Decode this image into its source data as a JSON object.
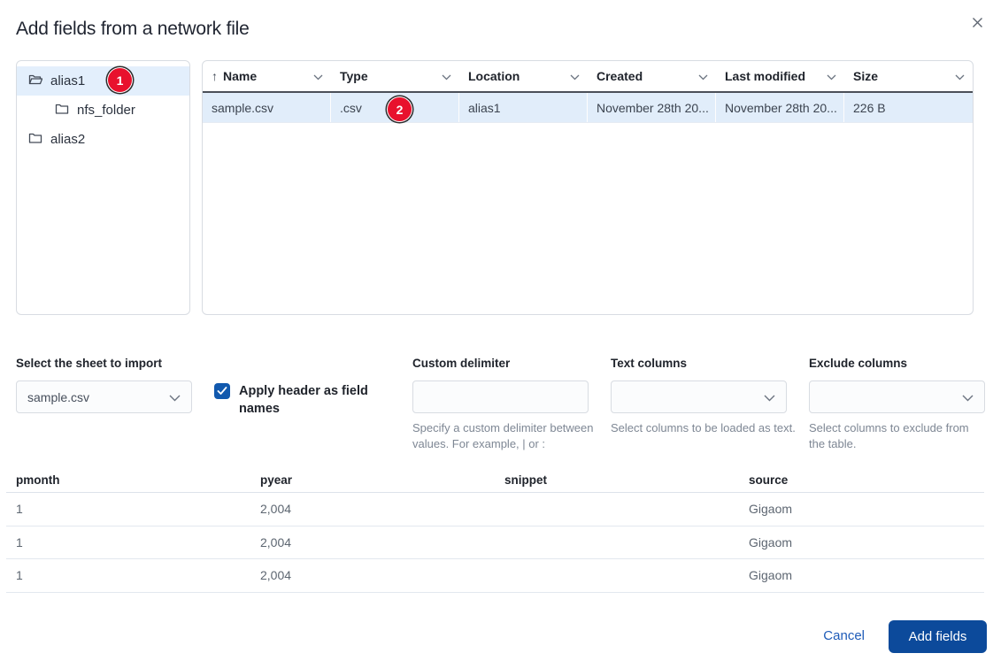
{
  "dialog": {
    "title": "Add fields from a network file"
  },
  "tree": {
    "items": [
      {
        "label": "alias1",
        "state": "open",
        "selected": true,
        "indent": 0
      },
      {
        "label": "nfs_folder",
        "state": "closed",
        "selected": false,
        "indent": 1
      },
      {
        "label": "alias2",
        "state": "closed",
        "selected": false,
        "indent": 0
      }
    ]
  },
  "files_table": {
    "columns": [
      "Name",
      "Type",
      "Location",
      "Created",
      "Last modified",
      "Size"
    ],
    "sort": {
      "column": "Name",
      "direction": "ascending"
    },
    "rows": [
      {
        "name": "sample.csv",
        "type": ".csv",
        "location": "alias1",
        "created": "November 28th 20...",
        "last_modified": "November 28th 20...",
        "size": "226 B",
        "selected": true
      }
    ]
  },
  "options": {
    "sheet": {
      "label": "Select the sheet to import",
      "value": "sample.csv"
    },
    "header_names": {
      "label": "Apply header as field names",
      "checked": true
    },
    "delimiter": {
      "label": "Custom delimiter",
      "value": "",
      "helper": "Specify a custom delimiter between values. For example, | or :"
    },
    "text_columns": {
      "label": "Text columns",
      "value": "",
      "helper": "Select columns to be loaded as text."
    },
    "exclude_columns": {
      "label": "Exclude columns",
      "value": "",
      "helper": "Select columns to exclude from the table."
    }
  },
  "preview_table": {
    "columns": [
      "pmonth",
      "pyear",
      "snippet",
      "source"
    ],
    "rows": [
      [
        "1",
        "2,004",
        "",
        "Gigaom"
      ],
      [
        "1",
        "2,004",
        "",
        "Gigaom"
      ],
      [
        "1",
        "2,004",
        "",
        "Gigaom"
      ]
    ]
  },
  "footer": {
    "cancel_label": "Cancel",
    "submit_label": "Add fields"
  },
  "annotations": [
    {
      "number": "1"
    },
    {
      "number": "2"
    }
  ],
  "colors": {
    "primary_button": "#0c4a9b",
    "link_blue": "#1e5bb8",
    "checkbox_blue": "#1159ae",
    "selected_row_bg": "#e1edfa",
    "tree_selected_bg": "#e3effc",
    "badge_red": "#e8112d",
    "header_border": "#4b5058"
  }
}
